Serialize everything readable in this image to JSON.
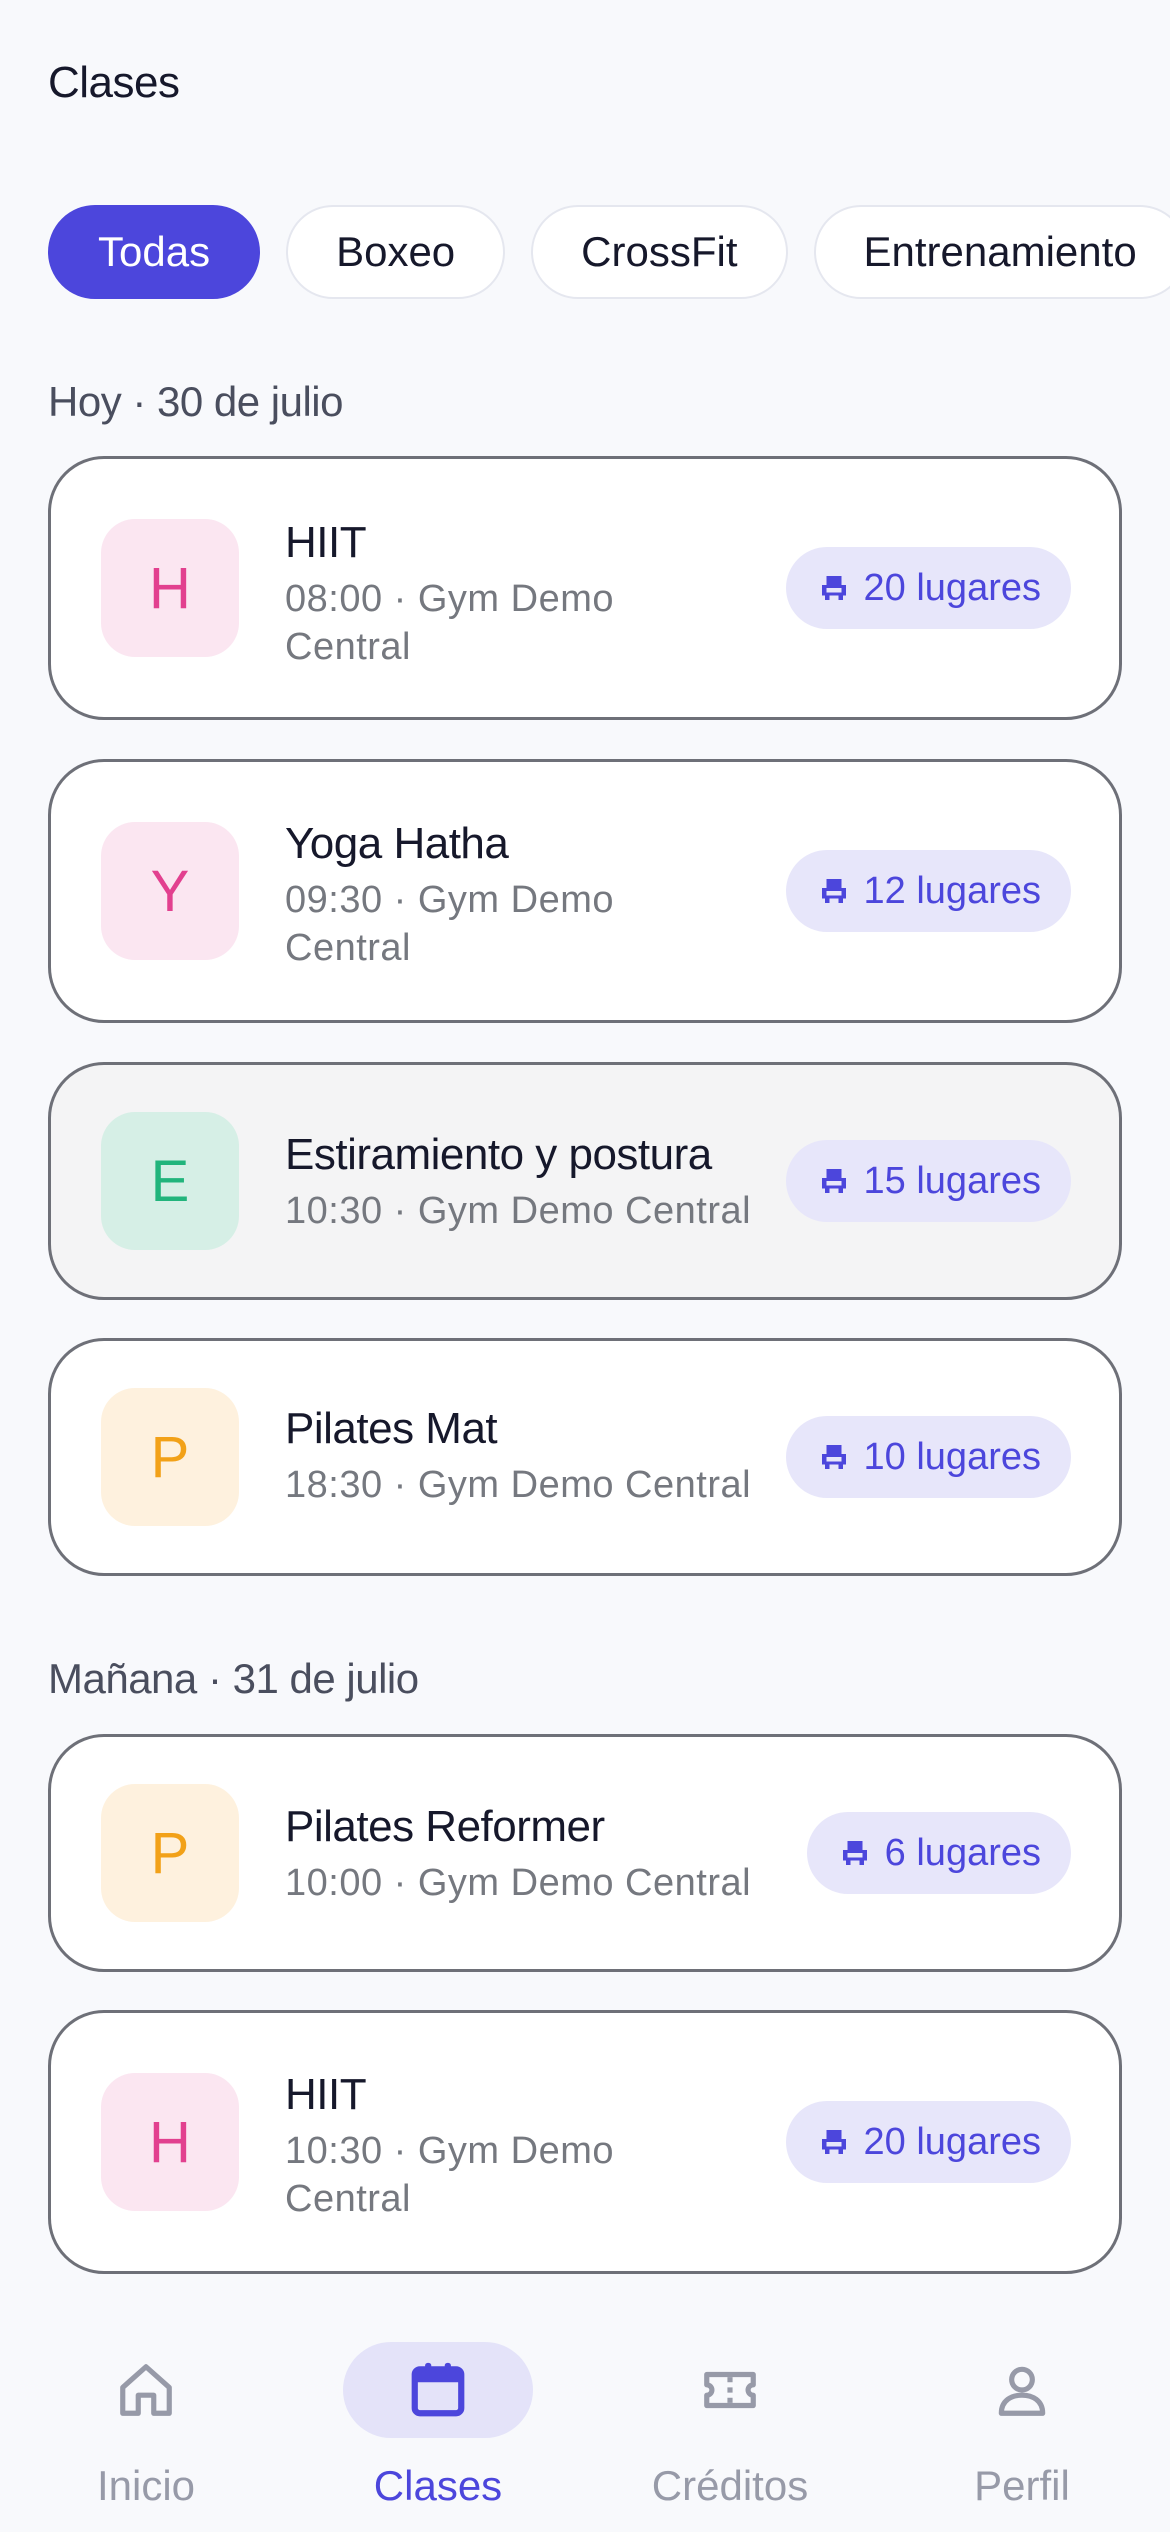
{
  "header": {
    "title": "Clases"
  },
  "filters": [
    "Todas",
    "Boxeo",
    "CrossFit",
    "Entrenamiento"
  ],
  "sections": [
    {
      "title": "Hoy · 30 de julio",
      "classes": [
        {
          "initial": "H",
          "name": "HIIT",
          "meta": "08:00 · Gym Demo Central",
          "spots": "20 lugares"
        },
        {
          "initial": "Y",
          "name": "Yoga Hatha",
          "meta": "09:30 · Gym Demo Central",
          "spots": "12 lugares"
        },
        {
          "initial": "E",
          "name": "Estiramiento y postura",
          "meta": "10:30 · Gym Demo Central",
          "spots": "15 lugares"
        },
        {
          "initial": "P",
          "name": "Pilates Mat",
          "meta": "18:30 · Gym Demo Central",
          "spots": "10 lugares"
        }
      ]
    },
    {
      "title": "Mañana · 31 de julio",
      "classes": [
        {
          "initial": "P",
          "name": "Pilates Reformer",
          "meta": "10:00 · Gym Demo Central",
          "spots": "6 lugares"
        },
        {
          "initial": "H",
          "name": "HIIT",
          "meta": "10:30 · Gym Demo Central",
          "spots": "20 lugares"
        }
      ]
    }
  ],
  "nav": {
    "home": "Inicio",
    "classes": "Clases",
    "credits": "Créditos",
    "profile": "Perfil"
  },
  "colors": {
    "accent": "#4c46dc",
    "pink": "#e2408f",
    "green": "#22b47c",
    "orange": "#f2a118"
  },
  "icons": {
    "spots": "seat-icon",
    "home": "home-icon",
    "classes": "calendar-icon",
    "credits": "ticket-icon",
    "profile": "user-icon"
  }
}
